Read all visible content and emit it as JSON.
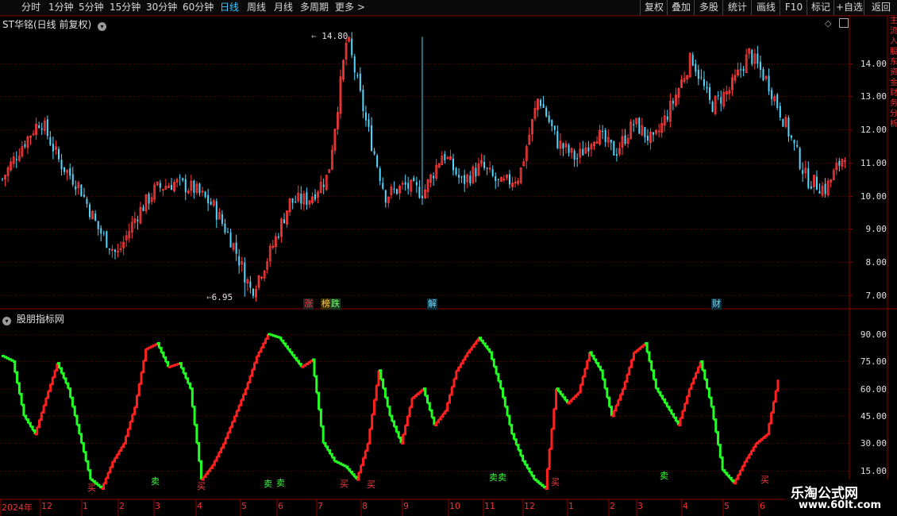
{
  "toolbar": {
    "left_items": [
      "分时",
      "1分钟",
      "5分钟",
      "15分钟",
      "30分钟",
      "60分钟",
      "日线",
      "周线",
      "月线",
      "多周期",
      "更多 >"
    ],
    "active_item": "日线",
    "right_items": [
      "复权",
      "叠加",
      "多股",
      "统计",
      "画线",
      "F10",
      "标记",
      "+自选",
      "返回"
    ]
  },
  "main_chart": {
    "title": "ST华铭(日线 前复权)",
    "price_ticks": [
      "14.00",
      "13.00",
      "12.00",
      "11.00",
      "10.00",
      "9.00",
      "8.00",
      "7.00"
    ],
    "high_label": "14.80",
    "low_label": "6.95",
    "event_markers": [
      {
        "text": "涨",
        "color": "#ff3b3b",
        "bg": "#222"
      },
      {
        "text": "榜",
        "color": "#ffd24a",
        "bg": "#3a2a00"
      },
      {
        "text": "跌",
        "color": "#7dff7d",
        "bg": "#1f3a1f"
      },
      {
        "text": "解",
        "color": "#6fd6ff",
        "bg": "#0f2f3a"
      },
      {
        "text": "财",
        "color": "#6fd6ff",
        "bg": "#0f2f3a"
      }
    ]
  },
  "indicator": {
    "title": "股朋指标网",
    "ticks": [
      "90.00",
      "75.00",
      "60.00",
      "45.00",
      "30.00",
      "15.00"
    ],
    "signals": [
      {
        "text": "买",
        "color": "#ff3b3b"
      },
      {
        "text": "卖",
        "color": "#3bff3b"
      },
      {
        "text": "买",
        "color": "#ff3b3b"
      },
      {
        "text": "卖",
        "color": "#3bff3b"
      },
      {
        "text": "卖",
        "color": "#3bff3b"
      },
      {
        "text": "买",
        "color": "#ff3b3b"
      },
      {
        "text": "买",
        "color": "#ff3b3b"
      },
      {
        "text": "卖卖",
        "color": "#3bff3b"
      },
      {
        "text": "买",
        "color": "#ff3b3b"
      },
      {
        "text": "卖",
        "color": "#3bff3b"
      },
      {
        "text": "买",
        "color": "#ff3b3b"
      }
    ]
  },
  "x_axis": {
    "labels": [
      "2024年",
      "12",
      "1",
      "2",
      "3",
      "4",
      "5",
      "6",
      "7",
      "8",
      "9",
      "10",
      "11",
      "12",
      "1",
      "2",
      "3",
      "4",
      "5",
      "6"
    ]
  },
  "watermark": {
    "line1": "乐淘公式网",
    "line2": "www.60lt.com"
  },
  "edge_text": "主流入股东资金财务分析",
  "colors": {
    "up": "#ff3b3b",
    "down": "#54d8ff",
    "ind_up": "#ff2020",
    "ind_down": "#22ff22",
    "grid": "#5a0000",
    "active_tab": "#3ec8ff"
  },
  "chart_data": [
    {
      "type": "candlestick",
      "title": "ST华铭(日线 前复权)",
      "ylim": [
        6.8,
        15.0
      ],
      "x": [
        "2024-11",
        "2024-12",
        "2025-01",
        "2025-02",
        "2025-03",
        "2025-04",
        "2025-05",
        "2025-06",
        "2025-07",
        "2025-08",
        "2025-09",
        "2025-10",
        "2025-11",
        "2025-12",
        "2026-01",
        "2026-02",
        "2026-03",
        "2026-04",
        "2026-05",
        "2026-06"
      ],
      "close_path": [
        10.5,
        11.5,
        12.3,
        11.0,
        10.3,
        9.0,
        8.2,
        9.4,
        10.2,
        10.4,
        10.2,
        9.7,
        8.6,
        7.1,
        8.3,
        9.8,
        9.9,
        10.6,
        14.8,
        12.2,
        10.0,
        10.3,
        10.1,
        11.3,
        10.4,
        10.9,
        10.3,
        10.6,
        13.0,
        11.6,
        11.1,
        11.9,
        11.3,
        12.2,
        11.6,
        12.8,
        14.2,
        12.7,
        13.2,
        14.3,
        13.4,
        12.0,
        10.5,
        10.2,
        11.3
      ],
      "max": 14.8,
      "min": 6.95
    },
    {
      "type": "line",
      "title": "股朋指标网",
      "ylim": [
        0,
        97
      ],
      "values": [
        78,
        75,
        45,
        35,
        55,
        74,
        60,
        35,
        10,
        5,
        20,
        30,
        50,
        82,
        85,
        72,
        74,
        60,
        10,
        18,
        30,
        45,
        60,
        78,
        90,
        88,
        80,
        72,
        76,
        30,
        20,
        17,
        10,
        30,
        70,
        45,
        30,
        55,
        60,
        40,
        48,
        70,
        80,
        88,
        80,
        60,
        35,
        20,
        10,
        5,
        60,
        52,
        58,
        80,
        70,
        45,
        60,
        80,
        85,
        60,
        50,
        40,
        60,
        75,
        50,
        15,
        8,
        20,
        30,
        35,
        65
      ]
    }
  ]
}
